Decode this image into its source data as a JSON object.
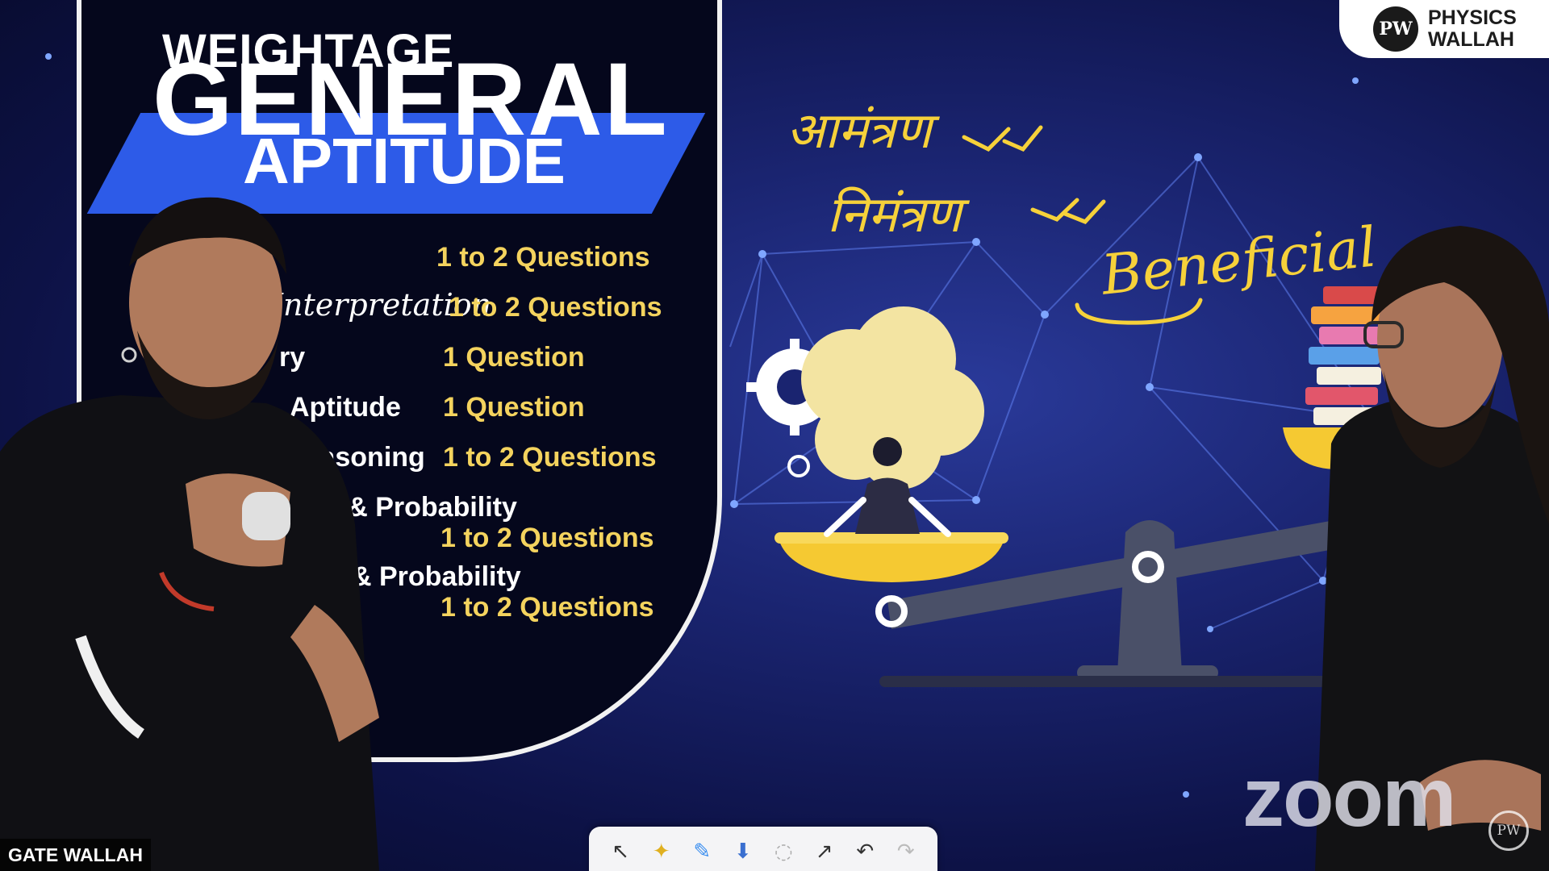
{
  "slide": {
    "heading_small": "WEIGHTAGE",
    "heading_big": "GENERAL",
    "heading_sub": "APTITUDE",
    "topics": [
      {
        "name": "",
        "count": "1 to 2 Questions"
      },
      {
        "name": "Interpretation",
        "count": "1 to 2 Questions"
      },
      {
        "name": "ry",
        "count": "1 Question"
      },
      {
        "name": "Aptitude",
        "count": "1 Question"
      },
      {
        "name": "Reasoning",
        "count": "1 to 2 Questions"
      },
      {
        "name": "n & Probability",
        "count": "1 to 2 Questions"
      },
      {
        "name": "& Probability",
        "count": "1 to 2 Questions"
      }
    ]
  },
  "annotations": {
    "hindi_word_1": "आमंत्रण",
    "hindi_word_2": "निमंत्रण",
    "english_word": "Beneficial",
    "ink_color": "#f6d13a"
  },
  "overlays": {
    "brand_line1": "PHYSICS",
    "brand_line2": "WALLAH",
    "brand_badge": "PW",
    "zoom_text": "zoom",
    "corner_badge": "PW",
    "channel_label": "GATE WALLAH"
  },
  "toolbar": {
    "tools": [
      {
        "name": "select-tool",
        "icon": "↖"
      },
      {
        "name": "spotlight-tool",
        "icon": "✦"
      },
      {
        "name": "pen-tool",
        "icon": "✎"
      },
      {
        "name": "stamp-tool",
        "icon": "⬇"
      },
      {
        "name": "eraser-tool",
        "icon": "◌"
      },
      {
        "name": "arrow-tool",
        "icon": "↗"
      },
      {
        "name": "undo-tool",
        "icon": "↶"
      },
      {
        "name": "redo-tool",
        "icon": "↷"
      }
    ]
  },
  "colors": {
    "accent_blue": "#2d5be8",
    "count_yellow": "#f4d35e",
    "scale_yellow": "#f5c932",
    "scale_grey": "#4a5068"
  }
}
